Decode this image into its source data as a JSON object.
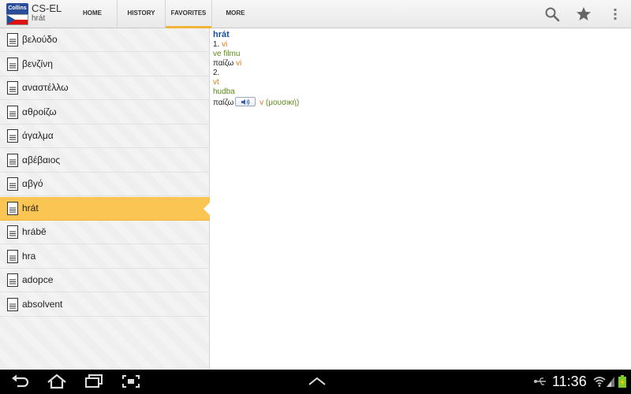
{
  "app": {
    "title": "CS-EL",
    "subtitle": "hrát",
    "logo_text": "Collins"
  },
  "tabs": [
    {
      "label": "HOME",
      "active": false
    },
    {
      "label": "HISTORY",
      "active": false
    },
    {
      "label": "FAVORITES",
      "active": true
    },
    {
      "label": "MORE",
      "active": false
    }
  ],
  "toolbar_icons": [
    "search-icon",
    "star-icon",
    "overflow-menu-icon"
  ],
  "list": [
    {
      "label": "βελούδο",
      "selected": false
    },
    {
      "label": "βενζίνη",
      "selected": false
    },
    {
      "label": "αναστέλλω",
      "selected": false
    },
    {
      "label": "αθροίζω",
      "selected": false
    },
    {
      "label": "άγαλμα",
      "selected": false
    },
    {
      "label": "αβέβαιος",
      "selected": false
    },
    {
      "label": "αβγό",
      "selected": false
    },
    {
      "label": "hrát",
      "selected": true
    },
    {
      "label": "hrábě",
      "selected": false
    },
    {
      "label": "hra",
      "selected": false
    },
    {
      "label": "adopce",
      "selected": false
    },
    {
      "label": "absolvent",
      "selected": false
    }
  ],
  "entry": {
    "headword": "hrát",
    "sense1_num": "1.",
    "sense1_pos": "vi",
    "sense1_context": "ve filmu",
    "sense1_trans": "παίζω",
    "sense1_trans_pos": "vi",
    "sense2_num": "2.",
    "sense2_pos": "vt",
    "sense2_context": "hudba",
    "sense2_trans": "παίζω",
    "sense2_trans_pos": "v",
    "sense2_trans_note": "(μουσική)"
  },
  "status": {
    "time": "11:36"
  },
  "colors": {
    "accent": "#f0b43a",
    "selected_row": "#fbc553",
    "headword": "#1a4f98",
    "pos": "#e07b13",
    "context": "#5b8a18"
  }
}
